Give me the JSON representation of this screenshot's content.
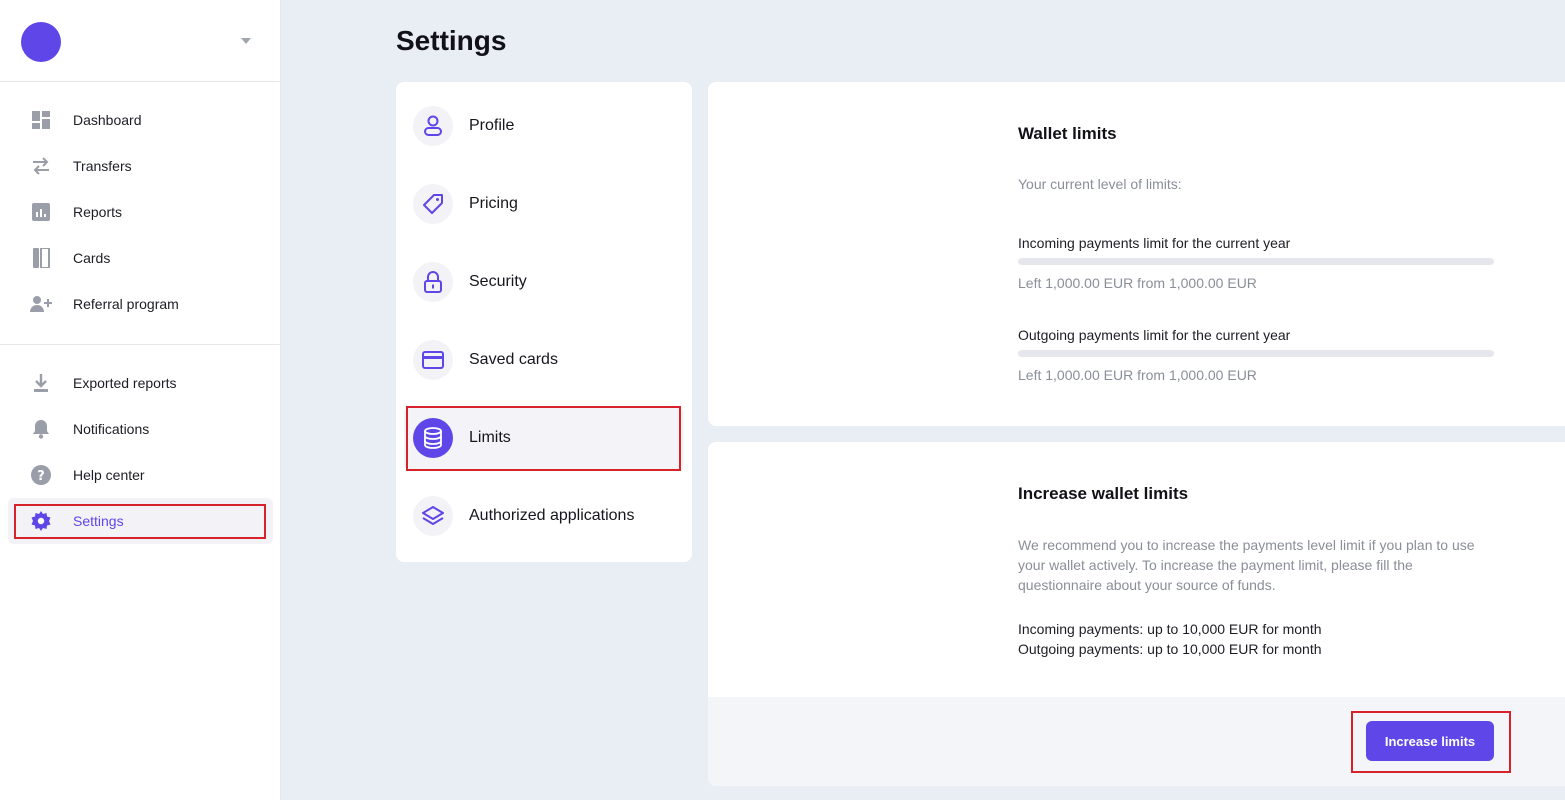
{
  "colors": {
    "accent": "#5f46e8",
    "highlight_border": "#d7212b",
    "background": "#e9edf4"
  },
  "sidebar": {
    "account_avatar_icon": "avatar-circle",
    "primary_items": [
      {
        "label": "Dashboard",
        "icon": "dashboard-icon"
      },
      {
        "label": "Transfers",
        "icon": "transfers-icon"
      },
      {
        "label": "Reports",
        "icon": "reports-icon"
      },
      {
        "label": "Cards",
        "icon": "cards-icon"
      },
      {
        "label": "Referral program",
        "icon": "add-user-icon"
      }
    ],
    "secondary_items": [
      {
        "label": "Exported reports",
        "icon": "download-icon"
      },
      {
        "label": "Notifications",
        "icon": "bell-icon"
      },
      {
        "label": "Help center",
        "icon": "help-icon"
      },
      {
        "label": "Settings",
        "icon": "gear-icon",
        "active": true
      }
    ]
  },
  "page": {
    "title": "Settings"
  },
  "settings_menu": {
    "items": [
      {
        "label": "Profile",
        "icon": "user-icon"
      },
      {
        "label": "Pricing",
        "icon": "tag-icon"
      },
      {
        "label": "Security",
        "icon": "lock-icon"
      },
      {
        "label": "Saved cards",
        "icon": "credit-card-icon"
      },
      {
        "label": "Limits",
        "icon": "coins-stack-icon",
        "active": true
      },
      {
        "label": "Authorized applications",
        "icon": "layers-icon"
      }
    ]
  },
  "wallet_limits": {
    "title": "Wallet limits",
    "subtitle": "Your current level of limits:",
    "incoming": {
      "label": "Incoming payments limit for the current year",
      "status": "Left 1,000.00 EUR from 1,000.00 EUR",
      "used_fraction": 0
    },
    "outgoing": {
      "label": "Outgoing payments limit for the current year",
      "status": "Left 1,000.00 EUR from 1,000.00 EUR",
      "used_fraction": 0
    }
  },
  "increase_limits": {
    "title": "Increase wallet limits",
    "description_lines": [
      "We recommend you to increase the payments level limit if you plan to use",
      "your wallet actively. To increase the payment limit, please fill the",
      "questionnaire about your source of funds."
    ],
    "incoming_text": "Incoming payments: up to 10,000 EUR for month",
    "outgoing_text": "Outgoing payments: up to 10,000 EUR for month",
    "button_label": "Increase limits"
  }
}
